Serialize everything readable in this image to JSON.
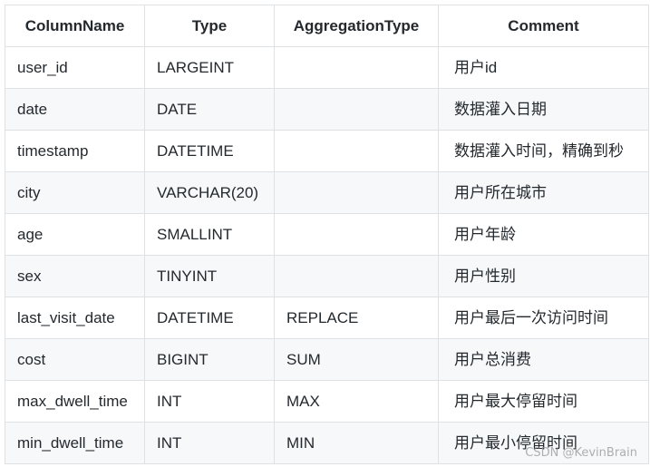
{
  "table": {
    "headers": [
      "ColumnName",
      "Type",
      "AggregationType",
      "Comment"
    ],
    "rows": [
      [
        "user_id",
        "LARGEINT",
        "",
        "用户id"
      ],
      [
        "date",
        "DATE",
        "",
        "数据灌入日期"
      ],
      [
        "timestamp",
        "DATETIME",
        "",
        "数据灌入时间，精确到秒"
      ],
      [
        "city",
        "VARCHAR(20)",
        "",
        "用户所在城市"
      ],
      [
        "age",
        "SMALLINT",
        "",
        "用户年龄"
      ],
      [
        "sex",
        "TINYINT",
        "",
        "用户性别"
      ],
      [
        "last_visit_date",
        "DATETIME",
        "REPLACE",
        "用户最后一次访问时间"
      ],
      [
        "cost",
        "BIGINT",
        "SUM",
        "用户总消费"
      ],
      [
        "max_dwell_time",
        "INT",
        "MAX",
        "用户最大停留时间"
      ],
      [
        "min_dwell_time",
        "INT",
        "MIN",
        "用户最小停留时间"
      ]
    ]
  },
  "watermark": "CSDN @KevinBrain",
  "colors": {
    "border": "#dfe2e5",
    "stripe": "#f6f8fa",
    "text": "#24292e"
  }
}
